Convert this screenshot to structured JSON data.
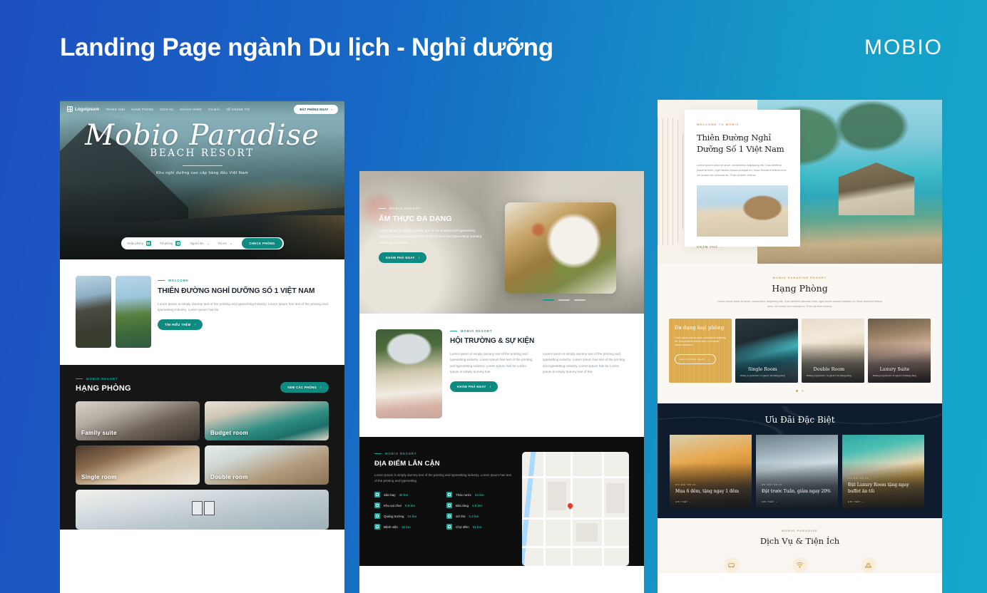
{
  "header": {
    "title": "Landing Page ngành Du lịch - Nghỉ dưỡng",
    "brand": "MOBIO",
    "bg_from": "#1e4fc0",
    "bg_to": "#14a8cb"
  },
  "mockup1": {
    "nav": {
      "logo": "Logoipsum",
      "links": [
        "TRANG CHỦ",
        "HẠNG PHÒNG",
        "DỊCH VỤ",
        "KHÁCH HÀNG",
        "ƯU ĐÃI",
        "VỀ CHÚNG TÔI"
      ],
      "cta": "ĐẶT PHÒNG NGAY",
      "cta_arrow": "›"
    },
    "hero": {
      "script_title": "Mobio Paradise",
      "sub_title": "BEACH RESORT",
      "tagline": "Khu nghỉ dưỡng cao cấp hàng đầu Việt Nam"
    },
    "booking": {
      "checkin": "Nhận phòng",
      "checkout": "Trả phòng",
      "adults": "Người lớn",
      "children": "Trẻ em",
      "submit": "CHECK PHÒNG",
      "chevron": "⌄"
    },
    "welcome": {
      "eyebrow": "WELCOME",
      "heading": "THIÊN ĐƯỜNG NGHỈ DƯỠNG SỐ 1 VIỆT NAM",
      "body": "Lorem Ipsum is simply dummy text of the printing and typesetting industry. Lorem Ipsum has text of the printing and typesetting industry. Lorem Ipsum has be",
      "cta": "TÌM HIỂU THÊM",
      "cta_arrow": "›"
    },
    "rooms": {
      "eyebrow": "MOBIO RESORT",
      "heading": "HẠNG PHÒNG",
      "cta": "XEM CÁC PHÒNG",
      "cta_arrow": "›",
      "items": [
        {
          "label": "Family suite"
        },
        {
          "label": "Budget room"
        },
        {
          "label": "Single room"
        },
        {
          "label": "Double room"
        }
      ]
    }
  },
  "mockup2": {
    "food": {
      "eyebrow": "MOBIO RESORT",
      "heading": "ẨM THỰC ĐA DẠNG",
      "body": "Lorem Ipsum is simply dummy text of the printing and typesetting industry. Lorem Ipsum has text of the printing and typesetting industry. Lorem Ipsum has be",
      "cta": "KHÁM PHÁ NGAY",
      "cta_arrow": "›"
    },
    "events": {
      "eyebrow": "MOBIO RESORT",
      "heading": "HỘI TRƯỜNG & SỰ KIỆN",
      "col1": "Lorem Ipsum is simply dummy text of the printing and typesetting industry. Lorem Ipsum has text of the printing and typesetting industry. Lorem Ipsum has be Lorem Ipsum is  simply dummy text",
      "col2": "Lorem Ipsum is simply dummy text of the printing and typesetting industry. Lorem Ipsum has text of the printing and typesetting industry. Lorem Ipsum has be Lorem Ipsum is  simply dummy text of the",
      "cta": "KHÁM PHÁ NGAY",
      "cta_arrow": "›"
    },
    "nearby": {
      "eyebrow": "MOBIO RESORT",
      "heading": "ĐỊA ĐIỂM LÂN CẬN",
      "body": "Lorem Ipsum is simply dummy text of the printing and typesetting industry. Lorem Ipsum has text of the printing and typesetting.",
      "items": [
        {
          "name": "Sân bay",
          "distance": "30 km"
        },
        {
          "name": "Thác nước",
          "distance": "04 km"
        },
        {
          "name": "Khu vui chơi",
          "distance": "0.5 km"
        },
        {
          "name": "Bảo tàng",
          "distance": "4.5 km"
        },
        {
          "name": "Quảng trường",
          "distance": "01 km"
        },
        {
          "name": "Sở thú",
          "distance": "1.2 km"
        },
        {
          "name": "Bệnh viện",
          "distance": "12 km"
        },
        {
          "name": "Chợ đêm",
          "distance": "01 km"
        }
      ]
    }
  },
  "mockup3": {
    "hero": {
      "eyebrow": "WELCOME TO MOBIO",
      "heading": "Thiên Đường Nghỉ Dưỡng Số 1 Việt Nam",
      "body": "Lorem ipsum dolor sit amet, consectetur adipiscing elit. Cras eleifend placerat enim, eget iaculis massa volutpat eu. Nunc tincidunt finibus eros, vel ornare est vehicula eu. Proin at enim viverra.",
      "link": "KHÁM PHÁ  →"
    },
    "rooms": {
      "eyebrow": "MOBIO PARADISE RESORT",
      "heading": "Hạng Phòng",
      "body": "Lorem ipsum dolor sit amet, consectetur adipiscing elit. Cras eleifend placerat enim, eget iaculis massa volutpat eu. Nunc tincidunt finibus eros, vel ornare est vehicula eu. Proin at enim viverra.",
      "promo_title": "Đa dạng loại phòng",
      "promo_body": "Lorem ipsum dolor sit amet, consectetur adipiscing elit. Cras eleifend placerat enim, eget iaculis massa volutpat eu.",
      "promo_cta": "ĐẶT PHÒNG NGAY",
      "promo_arrow": "→",
      "cards": [
        {
          "title": "Single Room",
          "sub": "Phòng 1 người lớn / 2 người / 24 phòng trống"
        },
        {
          "title": "Double Room",
          "sub": "Phòng 2 người lớn / 4 người / 12 phòng trống"
        },
        {
          "title": "Luxury Suite",
          "sub": "Phòng 4 người lớn / 6 người / 6 phòng trống"
        }
      ]
    },
    "offers": {
      "heading": "Ưu Đãi Đặc Biệt",
      "cards": [
        {
          "eyebrow": "ƯU ĐÃI SỐ 01",
          "title": "Mua 6 đêm, tặng ngay 1 đêm",
          "link": "CHI TIẾT  →"
        },
        {
          "eyebrow": "ƯU ĐÃI SỐ 02",
          "title": "Đặt trước Tuần, giảm ngay 20%",
          "link": "CHI TIẾT  →"
        },
        {
          "eyebrow": "ƯU ĐÃI SỐ 03",
          "title": "Đặt Luxury Room tặng ngay buffet ăn tối",
          "link": "CHI TIẾT  →"
        }
      ]
    },
    "services": {
      "eyebrow": "MOBIO PARADISE",
      "heading": "Dịch Vụ & Tiện Ích",
      "icons": [
        "car-icon",
        "wifi-icon",
        "laundry-icon"
      ]
    }
  }
}
